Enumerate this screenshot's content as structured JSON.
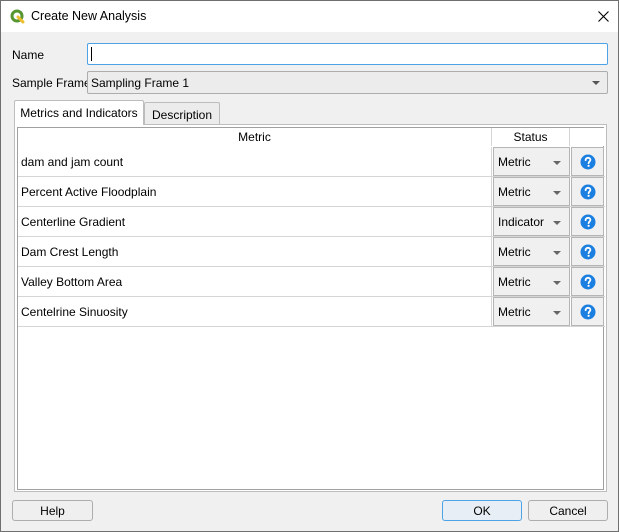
{
  "window": {
    "title": "Create New Analysis",
    "app_icon": "qgis-logo-icon",
    "close_icon": "close-icon"
  },
  "form": {
    "name_label": "Name",
    "name_value": "",
    "name_placeholder": "",
    "sample_frame_label": "Sample Frame",
    "sample_frame_value": "Sampling Frame 1"
  },
  "tabs": [
    {
      "label": "Metrics and Indicators",
      "active": true
    },
    {
      "label": "Description",
      "active": false
    }
  ],
  "table": {
    "columns": [
      "Metric",
      "Status",
      ""
    ],
    "rows": [
      {
        "metric": "dam and jam count",
        "status": "Metric",
        "help_icon": "question-circle-icon"
      },
      {
        "metric": "Percent Active Floodplain",
        "status": "Metric",
        "help_icon": "question-circle-icon"
      },
      {
        "metric": "Centerline Gradient",
        "status": "Indicator",
        "help_icon": "question-circle-icon"
      },
      {
        "metric": "Dam Crest Length",
        "status": "Metric",
        "help_icon": "question-circle-icon"
      },
      {
        "metric": "Valley Bottom Area",
        "status": "Metric",
        "help_icon": "question-circle-icon"
      },
      {
        "metric": "Centelrine Sinuosity",
        "status": "Metric",
        "help_icon": "question-circle-icon"
      }
    ]
  },
  "buttons": {
    "help": "Help",
    "ok": "OK",
    "cancel": "Cancel"
  },
  "colors": {
    "accent": "#4ea3e6",
    "help_icon": "#1a7fe0",
    "qgis_green": "#589632",
    "qgis_yellow": "#eebf2d"
  }
}
